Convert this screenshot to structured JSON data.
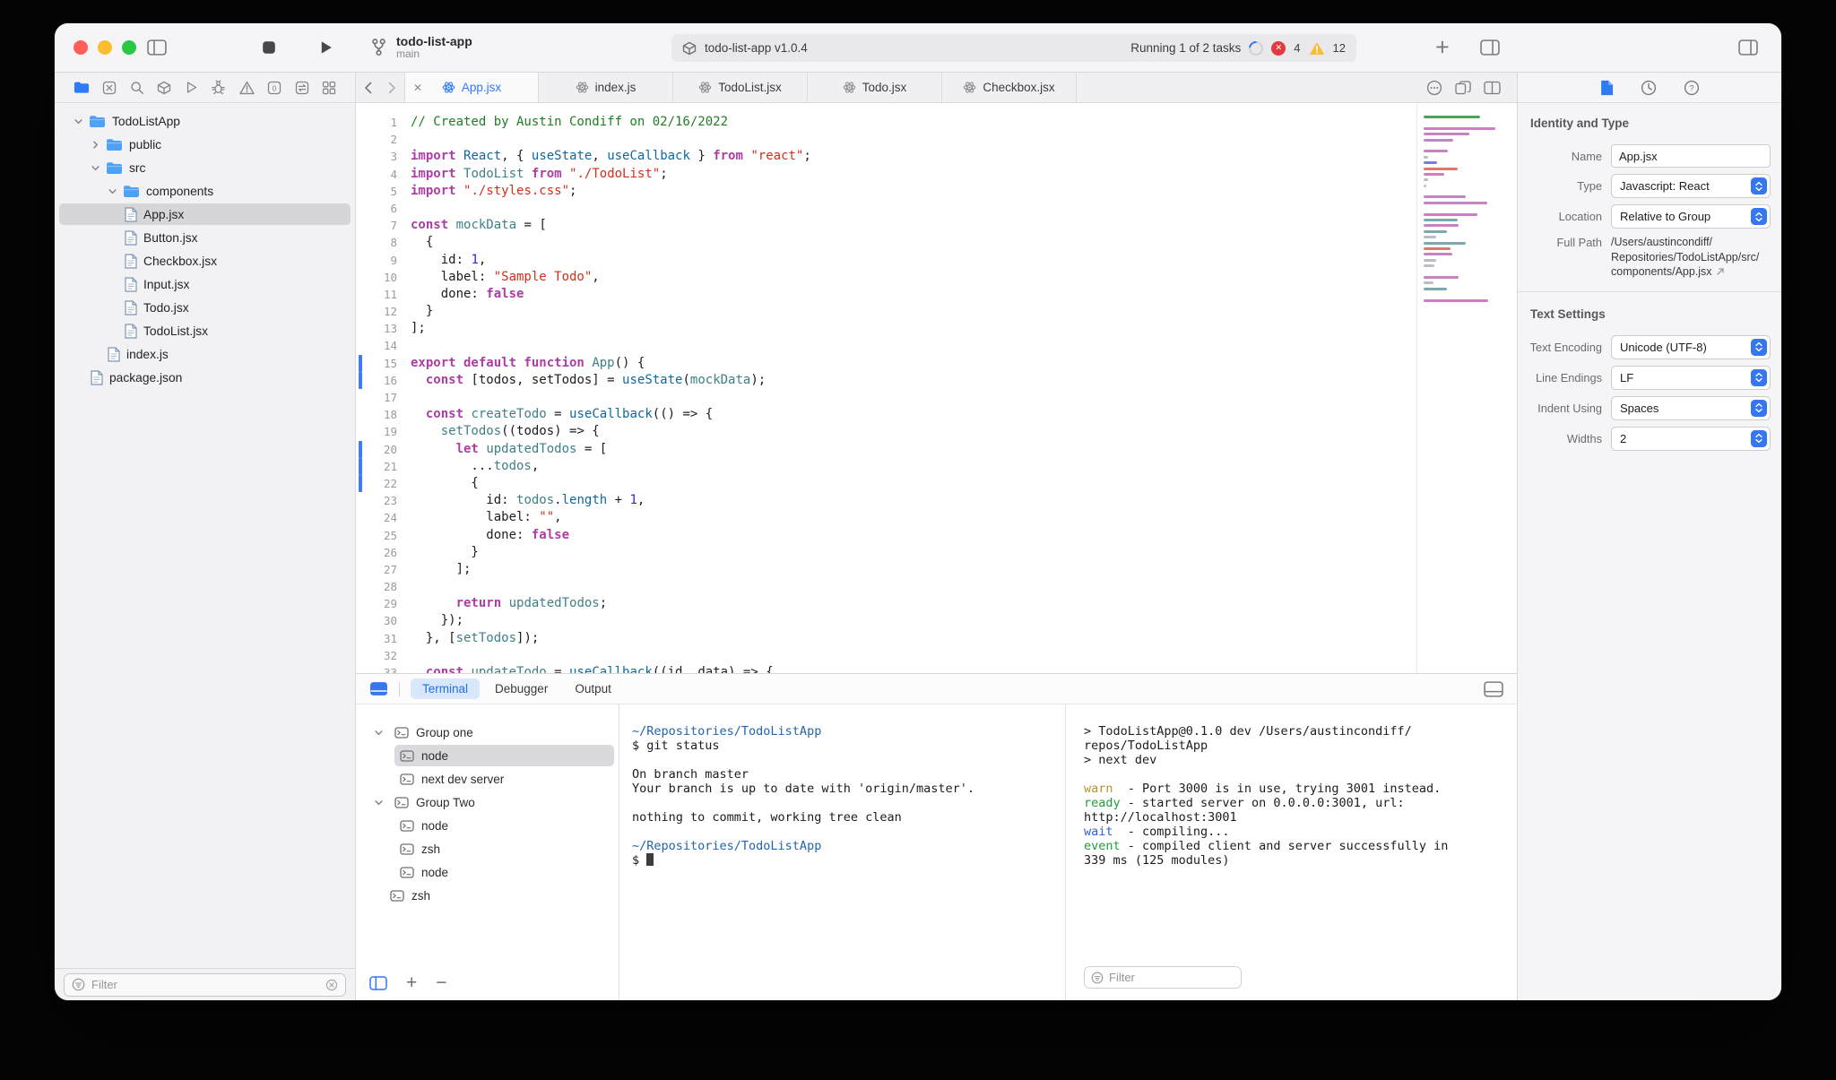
{
  "titlebar": {
    "project_name": "todo-list-app",
    "branch": "main",
    "activity_left": "todo-list-app v1.0.4",
    "activity_right": "Running 1 of 2 tasks",
    "errors": "4",
    "warnings": "12"
  },
  "sidebar": {
    "nav_icons": [
      "folder-icon",
      "xmark-square-icon",
      "search-icon",
      "cube-icon",
      "play-icon",
      "bug-icon",
      "warning-icon",
      "zero-square-icon",
      "swap-square-icon",
      "grid-icon"
    ],
    "filter_placeholder": "Filter",
    "tree": [
      {
        "label": "TodoListApp",
        "type": "folder",
        "depth": 0,
        "expanded": true
      },
      {
        "label": "public",
        "type": "folder",
        "depth": 1,
        "expanded": false
      },
      {
        "label": "src",
        "type": "folder",
        "depth": 1,
        "expanded": true
      },
      {
        "label": "components",
        "type": "folder",
        "depth": 2,
        "expanded": true
      },
      {
        "label": "App.jsx",
        "type": "file",
        "depth": 3,
        "selected": true
      },
      {
        "label": "Button.jsx",
        "type": "file",
        "depth": 3
      },
      {
        "label": "Checkbox.jsx",
        "type": "file",
        "depth": 3
      },
      {
        "label": "Input.jsx",
        "type": "file",
        "depth": 3
      },
      {
        "label": "Todo.jsx",
        "type": "file",
        "depth": 3
      },
      {
        "label": "TodoList.jsx",
        "type": "file",
        "depth": 3
      },
      {
        "label": "index.js",
        "type": "file",
        "depth": 2
      },
      {
        "label": "package.json",
        "type": "file",
        "depth": 1
      }
    ]
  },
  "editor": {
    "tabs": [
      {
        "label": "App.jsx",
        "active": true
      },
      {
        "label": "index.js",
        "active": false
      },
      {
        "label": "TodoList.jsx",
        "active": false
      },
      {
        "label": "Todo.jsx",
        "active": false
      },
      {
        "label": "Checkbox.jsx",
        "active": false
      }
    ],
    "changed_lines": [
      15,
      16,
      20,
      21,
      22
    ],
    "lines": [
      [
        [
          "c",
          "// Created by Austin Condiff on 02/16/2022"
        ]
      ],
      [],
      [
        [
          "k",
          "import"
        ],
        [
          "p",
          " "
        ],
        [
          "f",
          "React"
        ],
        [
          "p",
          ", { "
        ],
        [
          "f",
          "useState"
        ],
        [
          "p",
          ", "
        ],
        [
          "f",
          "useCallback"
        ],
        [
          "p",
          " } "
        ],
        [
          "k",
          "from"
        ],
        [
          "p",
          " "
        ],
        [
          "s",
          "\"react\""
        ],
        [
          "p",
          ";"
        ]
      ],
      [
        [
          "k",
          "import"
        ],
        [
          "p",
          " "
        ],
        [
          "t",
          "TodoList"
        ],
        [
          "p",
          " "
        ],
        [
          "k",
          "from"
        ],
        [
          "p",
          " "
        ],
        [
          "s",
          "\"./TodoList\""
        ],
        [
          "p",
          ";"
        ]
      ],
      [
        [
          "k",
          "import"
        ],
        [
          "p",
          " "
        ],
        [
          "s",
          "\"./styles.css\""
        ],
        [
          "p",
          ";"
        ]
      ],
      [],
      [
        [
          "k",
          "const"
        ],
        [
          "p",
          " "
        ],
        [
          "t",
          "mockData"
        ],
        [
          "p",
          " = ["
        ]
      ],
      [
        [
          "p",
          "  {"
        ]
      ],
      [
        [
          "p",
          "    id: "
        ],
        [
          "n",
          "1"
        ],
        [
          "p",
          ","
        ]
      ],
      [
        [
          "p",
          "    label: "
        ],
        [
          "s",
          "\"Sample Todo\""
        ],
        [
          "p",
          ","
        ]
      ],
      [
        [
          "p",
          "    done: "
        ],
        [
          "k",
          "false"
        ]
      ],
      [
        [
          "p",
          "  }"
        ]
      ],
      [
        [
          "p",
          "];"
        ]
      ],
      [],
      [
        [
          "k",
          "export default function"
        ],
        [
          "p",
          " "
        ],
        [
          "t",
          "App"
        ],
        [
          "p",
          "() {"
        ]
      ],
      [
        [
          "p",
          "  "
        ],
        [
          "k",
          "const"
        ],
        [
          "p",
          " [todos, setTodos] = "
        ],
        [
          "f",
          "useState"
        ],
        [
          "p",
          "("
        ],
        [
          "t",
          "mockData"
        ],
        [
          "p",
          ");"
        ]
      ],
      [],
      [
        [
          "p",
          "  "
        ],
        [
          "k",
          "const"
        ],
        [
          "p",
          " "
        ],
        [
          "t",
          "createTodo"
        ],
        [
          "p",
          " = "
        ],
        [
          "f",
          "useCallback"
        ],
        [
          "p",
          "(() => {"
        ]
      ],
      [
        [
          "p",
          "    "
        ],
        [
          "t",
          "setTodos"
        ],
        [
          "p",
          "((todos) => {"
        ]
      ],
      [
        [
          "p",
          "      "
        ],
        [
          "k",
          "let"
        ],
        [
          "p",
          " "
        ],
        [
          "t",
          "updatedTodos"
        ],
        [
          "p",
          " = ["
        ]
      ],
      [
        [
          "p",
          "        ..."
        ],
        [
          "t",
          "todos"
        ],
        [
          "p",
          ","
        ]
      ],
      [
        [
          "p",
          "        {"
        ]
      ],
      [
        [
          "p",
          "          id: "
        ],
        [
          "t",
          "todos"
        ],
        [
          "p",
          "."
        ],
        [
          "f",
          "length"
        ],
        [
          "p",
          " + "
        ],
        [
          "n",
          "1"
        ],
        [
          "p",
          ","
        ]
      ],
      [
        [
          "p",
          "          label: "
        ],
        [
          "s",
          "\"\""
        ],
        [
          "p",
          ","
        ]
      ],
      [
        [
          "p",
          "          done: "
        ],
        [
          "k",
          "false"
        ]
      ],
      [
        [
          "p",
          "        }"
        ]
      ],
      [
        [
          "p",
          "      ];"
        ]
      ],
      [],
      [
        [
          "p",
          "      "
        ],
        [
          "k",
          "return"
        ],
        [
          "p",
          " "
        ],
        [
          "t",
          "updatedTodos"
        ],
        [
          "p",
          ";"
        ]
      ],
      [
        [
          "p",
          "    });"
        ]
      ],
      [
        [
          "p",
          "  }, ["
        ],
        [
          "t",
          "setTodos"
        ],
        [
          "p",
          "]);"
        ]
      ],
      [],
      [
        [
          "p",
          "  "
        ],
        [
          "k",
          "const"
        ],
        [
          "p",
          " "
        ],
        [
          "t",
          "updateTodo"
        ],
        [
          "p",
          " = "
        ],
        [
          "f",
          "useCallback"
        ],
        [
          "p",
          "((id, data) => {"
        ]
      ]
    ]
  },
  "panel": {
    "tabs": [
      {
        "label": "Terminal",
        "active": true
      },
      {
        "label": "Debugger",
        "active": false
      },
      {
        "label": "Output",
        "active": false
      }
    ],
    "tasks": [
      {
        "label": "Group one",
        "kind": "group",
        "expanded": true,
        "selected": false
      },
      {
        "label": "node",
        "kind": "item",
        "selected": true
      },
      {
        "label": "next dev server",
        "kind": "item",
        "selected": false
      },
      {
        "label": "Group Two",
        "kind": "group",
        "expanded": true,
        "selected": false
      },
      {
        "label": "node",
        "kind": "item",
        "selected": false
      },
      {
        "label": "zsh",
        "kind": "item",
        "selected": false
      },
      {
        "label": "node",
        "kind": "item",
        "selected": false
      },
      {
        "label": "zsh",
        "kind": "root-item",
        "selected": false
      }
    ],
    "terminal1": [
      [
        [
          "path",
          "~/Repositories/TodoListApp"
        ]
      ],
      [
        [
          "p",
          "$ git status"
        ]
      ],
      [],
      [
        [
          "p",
          "On branch master"
        ]
      ],
      [
        [
          "p",
          "Your branch is up to date with 'origin/master'."
        ]
      ],
      [],
      [
        [
          "p",
          "nothing to commit, working tree clean"
        ]
      ],
      [],
      [
        [
          "path",
          "~/Repositories/TodoListApp"
        ]
      ],
      [
        [
          "p",
          "$ "
        ],
        [
          "cursor",
          ""
        ]
      ]
    ],
    "terminal2": [
      [
        [
          "p",
          "> TodoListApp@0.1.0 dev /Users/austincondiff/repos/TodoListApp"
        ]
      ],
      [
        [
          "p",
          "> next dev"
        ]
      ],
      [],
      [
        [
          "warn",
          "warn"
        ],
        [
          "p",
          "  - Port 3000 is in use, trying 3001 instead."
        ]
      ],
      [
        [
          "ready",
          "ready"
        ],
        [
          "p",
          " - started server on 0.0.0.0:3001, url: http://localhost:3001"
        ]
      ],
      [
        [
          "wait",
          "wait"
        ],
        [
          "p",
          "  - compiling..."
        ]
      ],
      [
        [
          "event",
          "event"
        ],
        [
          "p",
          " - compiled client and server successfully in 339 ms (125 modules)"
        ]
      ]
    ],
    "filter_placeholder": "Filter"
  },
  "inspector": {
    "section1": "Identity and Type",
    "name_label": "Name",
    "name_value": "App.jsx",
    "type_label": "Type",
    "type_value": "Javascript: React",
    "location_label": "Location",
    "location_value": "Relative to Group",
    "fullpath_label": "Full Path",
    "fullpath_value": "/Users/austincondiff/Repositories/TodoListApp/src/components/App.jsx",
    "section2": "Text Settings",
    "encoding_label": "Text Encoding",
    "encoding_value": "Unicode (UTF-8)",
    "lineendings_label": "Line Endings",
    "lineendings_value": "LF",
    "indent_label": "Indent Using",
    "indent_value": "Spaces",
    "widths_label": "Widths",
    "widths_value": "2"
  }
}
